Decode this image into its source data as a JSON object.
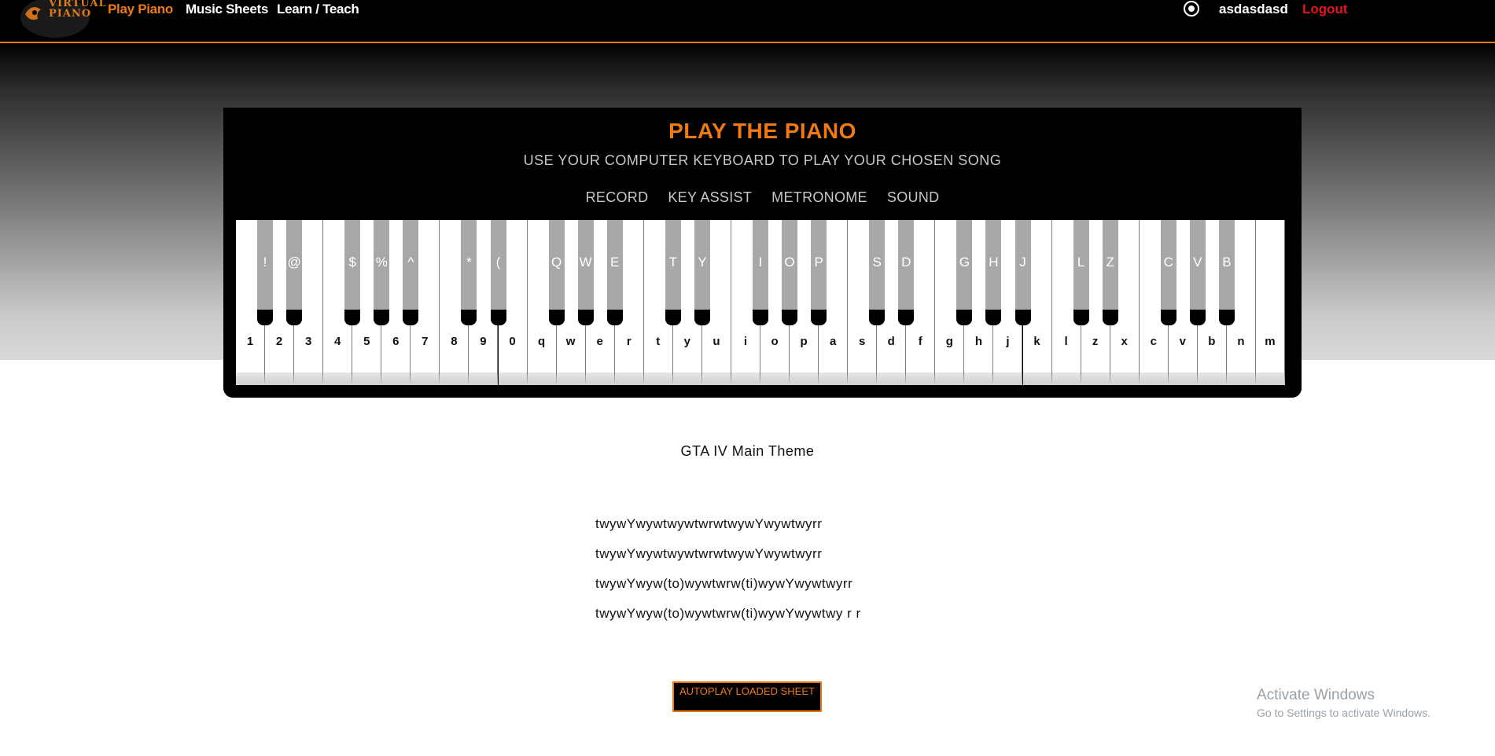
{
  "navbar": {
    "logo_text": "VIRTUAL PIANO",
    "links": [
      "Play Piano",
      "Music Sheets",
      "Learn / Teach"
    ],
    "username": "asdasdasd",
    "logout": "Logout",
    "accent_color": "#f07a12",
    "logout_color": "#e8141c"
  },
  "panel": {
    "title": "PLAY THE PIANO",
    "subtitle": "USE YOUR COMPUTER KEYBOARD TO PLAY YOUR CHOSEN SONG",
    "menu": [
      "RECORD",
      "KEY ASSIST",
      "METRONOME",
      "SOUND"
    ]
  },
  "keyboard": {
    "white_keys": [
      "1",
      "2",
      "3",
      "4",
      "5",
      "6",
      "7",
      "8",
      "9",
      "0",
      "q",
      "w",
      "e",
      "r",
      "t",
      "y",
      "u",
      "i",
      "o",
      "p",
      "a",
      "s",
      "d",
      "f",
      "g",
      "h",
      "j",
      "k",
      "l",
      "z",
      "x",
      "c",
      "v",
      "b",
      "n",
      "m"
    ],
    "black_keys": [
      "!",
      "@",
      "",
      "$",
      "%",
      "^",
      "",
      "*",
      "(",
      "",
      "Q",
      "W",
      "E",
      "",
      "T",
      "Y",
      "",
      "I",
      "O",
      "P",
      "",
      "S",
      "D",
      "",
      "G",
      "H",
      "J",
      "",
      "L",
      "Z",
      "",
      "C",
      "V",
      "B",
      "",
      ""
    ]
  },
  "song": {
    "title": "GTA IV Main Theme",
    "lines": [
      "twywYwywtwywtwrwtwywYwywtwyrr",
      "twywYwywtwywtwrwtwywYwywtwyrr",
      "twywYwyw(to)wywtwrw(ti)wywYwywtwyrr",
      "twywYwyw(to)wywtwrw(ti)wywYwywtwy r r"
    ],
    "autoplay_label": "AUTOPLAY LOADED SHEET"
  },
  "watermark": {
    "title": "Activate Windows",
    "subtitle": "Go to Settings to activate Windows."
  }
}
